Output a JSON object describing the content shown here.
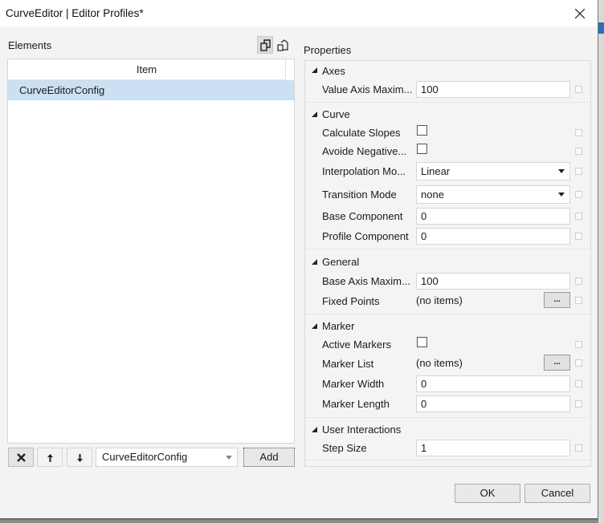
{
  "window": {
    "title": "CurveEditor | Editor Profiles*",
    "close_icon": "close-x-icon"
  },
  "elements_panel": {
    "label": "Elements",
    "toolbar": [
      {
        "name": "clone-icon",
        "active": true
      },
      {
        "name": "paste-icon",
        "active": false
      }
    ],
    "list": {
      "column_header": "Item",
      "items": [
        {
          "label": "CurveEditorConfig",
          "selected": true
        }
      ]
    },
    "bottom_bar": {
      "remove_icon": "x-icon",
      "move_up_icon": "arrow-up-icon",
      "move_down_icon": "arrow-down-icon",
      "type_combo_value": "CurveEditorConfig",
      "add_label": "Add"
    }
  },
  "properties_panel": {
    "label": "Properties",
    "categories": [
      {
        "title": "Axes",
        "properties": [
          {
            "label": "Value Axis Maxim...",
            "type": "text",
            "value": "100"
          }
        ]
      },
      {
        "title": "Curve",
        "properties": [
          {
            "label": "Calculate Slopes",
            "type": "checkbox",
            "checked": false
          },
          {
            "label": "Avoide Negative...",
            "type": "checkbox",
            "checked": false
          },
          {
            "label": "Interpolation Mo...",
            "type": "select",
            "value": "Linear"
          },
          {
            "label": "Transition Mode",
            "type": "select",
            "value": "none"
          },
          {
            "label": "Base Component",
            "type": "text",
            "value": "0"
          },
          {
            "label": "Profile Component",
            "type": "text",
            "value": "0"
          }
        ]
      },
      {
        "title": "General",
        "properties": [
          {
            "label": "Base Axis Maxim...",
            "type": "text",
            "value": "100"
          },
          {
            "label": "Fixed Points",
            "type": "collection",
            "value": "(no items)",
            "button": "..."
          }
        ]
      },
      {
        "title": "Marker",
        "properties": [
          {
            "label": "Active Markers",
            "type": "checkbox",
            "checked": false
          },
          {
            "label": "Marker List",
            "type": "collection",
            "value": "(no items)",
            "button": "..."
          },
          {
            "label": "Marker Width",
            "type": "text",
            "value": "0"
          },
          {
            "label": "Marker Length",
            "type": "text",
            "value": "0"
          }
        ]
      },
      {
        "title": "User Interactions",
        "properties": [
          {
            "label": "Step Size",
            "type": "text",
            "value": "1"
          }
        ]
      }
    ]
  },
  "footer": {
    "ok_label": "OK",
    "cancel_label": "Cancel"
  }
}
